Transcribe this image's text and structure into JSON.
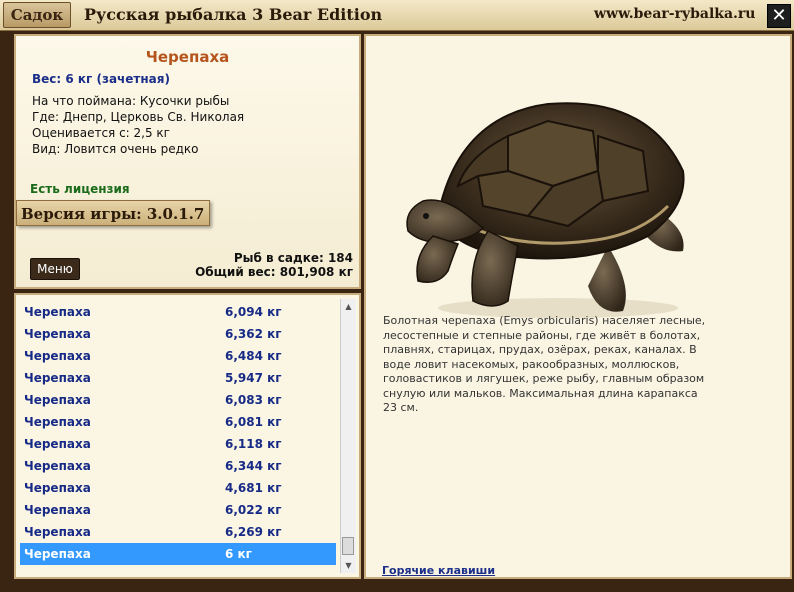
{
  "titlebar": {
    "tab": "Садок",
    "title": "Русская рыбалка 3 Bear Edition",
    "url": "www.bear-rybalka.ru",
    "close": "✕"
  },
  "info": {
    "name": "Черепаха",
    "weight": "Вес: 6 кг (зачетная)",
    "caught_with": "На что поймана: Кусочки рыбы",
    "where": "Где: Днепр, Церковь Св. Николая",
    "value": "Оценивается с: 2,5 кг",
    "rarity": "Вид: Ловится очень редко",
    "license": "Есть лицензия",
    "version": "Версия игры: 3.0.1.7",
    "menu": "Меню",
    "fish_count": "Рыб в садке: 184",
    "total_weight": "Общий вес: 801,908 кг"
  },
  "list": [
    {
      "name": "Черепаха",
      "weight": "6,094 кг"
    },
    {
      "name": "Черепаха",
      "weight": "6,362 кг"
    },
    {
      "name": "Черепаха",
      "weight": "6,484 кг"
    },
    {
      "name": "Черепаха",
      "weight": "5,947 кг"
    },
    {
      "name": "Черепаха",
      "weight": "6,083 кг"
    },
    {
      "name": "Черепаха",
      "weight": "6,081 кг"
    },
    {
      "name": "Черепаха",
      "weight": "6,118 кг"
    },
    {
      "name": "Черепаха",
      "weight": "6,344 кг"
    },
    {
      "name": "Черепаха",
      "weight": "4,681 кг"
    },
    {
      "name": "Черепаха",
      "weight": "6,022 кг"
    },
    {
      "name": "Черепаха",
      "weight": "6,269 кг"
    },
    {
      "name": "Черепаха",
      "weight": "6 кг"
    }
  ],
  "selected_index": 11,
  "scroll": {
    "up": "▲",
    "down": "▼"
  },
  "detail": {
    "description": "Болотная черепаха (Emys orbicularis) населяет лесные, лесостепные и степные районы, где живёт в болотах, плавнях, старицах, прудах, озёрах, реках, каналах. В воде ловит насекомых, ракообразных, моллюсков, головастиков и лягушек, реже рыбу, главным образом снулую или мальков. Максимальная длина карапакса 23 см.",
    "hotkeys": "Горячие клавиши"
  },
  "colors": {
    "title_orange": "#b5541c",
    "list_blue": "#162a86",
    "selection": "#3399ff",
    "license_green": "#1a6b1a"
  }
}
